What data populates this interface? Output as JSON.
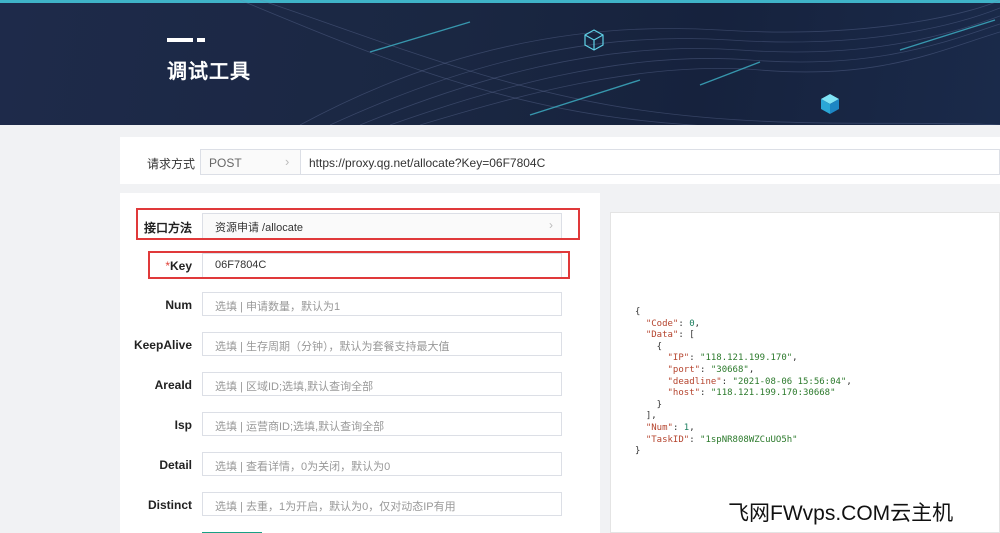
{
  "page": {
    "title": "调试工具"
  },
  "request": {
    "method_label": "请求方式",
    "method_value": "POST",
    "url": "https://proxy.qg.net/allocate?Key=06F7804C"
  },
  "form": {
    "rows": [
      {
        "id": "interface",
        "label": "接口方法",
        "value": "资源申请  /allocate",
        "filled": true,
        "arrow": true
      },
      {
        "id": "key",
        "label": "Key",
        "required": true,
        "value": "06F7804C",
        "filled": true
      },
      {
        "id": "num",
        "label": "Num",
        "value": "选填 | 申请数量，默认为1"
      },
      {
        "id": "keepalive",
        "label": "KeepAlive",
        "value": "选填 | 生存周期（分钟），默认为套餐支持最大值"
      },
      {
        "id": "areaid",
        "label": "AreaId",
        "value": "选填 | 区域ID;选填,默认查询全部"
      },
      {
        "id": "isp",
        "label": "Isp",
        "value": "选填 | 运营商ID;选填,默认查询全部"
      },
      {
        "id": "detail",
        "label": "Detail",
        "value": "选填 | 查看详情，0为关闭，默认为0"
      },
      {
        "id": "distinct",
        "label": "Distinct",
        "value": "选填 | 去重，1为开启，默认为0，仅对动态IP有用"
      }
    ]
  },
  "response": {
    "Code": 0,
    "Data": [
      {
        "IP": "118.121.199.170",
        "port": "30668",
        "deadline": "2021-08-06 15:56:04",
        "host": "118.121.199.170:30668"
      }
    ],
    "Num": 1,
    "TaskID": "1spNR808WZCuUO5h"
  },
  "watermark": "飞网FWvps.COM云主机",
  "colors": {
    "banner": "#1a2742",
    "highlight": "#e0393a",
    "accent": "#3fb3c8"
  }
}
